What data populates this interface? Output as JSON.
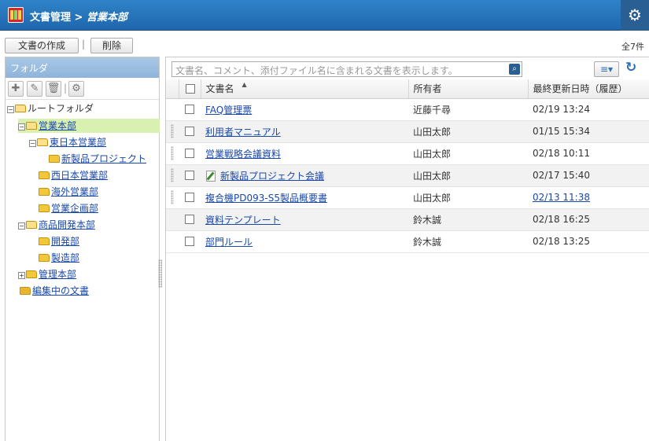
{
  "header": {
    "title_prefix": "文書管理 > ",
    "current": "営業本部",
    "settings_icon": "gear-icon"
  },
  "toolbar": {
    "create_label": "文書の作成",
    "separator": "|",
    "delete_label": "削除",
    "count": "全7件"
  },
  "folder_panel": {
    "title": "フォルダ",
    "tools": [
      "plus-icon",
      "pencil-icon",
      "trash-icon",
      "gear-icon"
    ],
    "tree": {
      "root": "ルートフォルダ",
      "eigyo": "営業本部",
      "higashi": "東日本営業部",
      "shinseihin": "新製品プロジェクト",
      "nishi": "西日本営業部",
      "kaigai": "海外営業部",
      "kikaku": "営業企画部",
      "shohin": "商品開発本部",
      "kaihatsu": "開発部",
      "seizo": "製造部",
      "kanri": "管理本部",
      "editing": "編集中の文書"
    }
  },
  "search": {
    "placeholder": "文書名、コメント、添付ファイル名に含まれる文書を表示します。"
  },
  "table": {
    "columns": [
      "文書名",
      "所有者",
      "最終更新日時（履歴）"
    ],
    "rows": [
      {
        "name": "FAQ管理票",
        "owner": "近藤千尋",
        "updated": "02/19 13:24"
      },
      {
        "name": "利用者マニュアル",
        "owner": "山田太郎",
        "updated": "01/15 15:34"
      },
      {
        "name": "営業戦略会議資料",
        "owner": "山田太郎",
        "updated": "02/18 10:11"
      },
      {
        "name": "新製品プロジェクト会議",
        "owner": "山田太郎",
        "updated": "02/17 15:40"
      },
      {
        "name": "複合機PD093-S5製品概要書",
        "owner": "山田太郎",
        "updated": "02/13 11:38"
      },
      {
        "name": "資料テンプレート",
        "owner": "鈴木誠",
        "updated": "02/18 16:25"
      },
      {
        "name": "部門ルール",
        "owner": "鈴木誠",
        "updated": "02/18 13:25"
      }
    ]
  }
}
